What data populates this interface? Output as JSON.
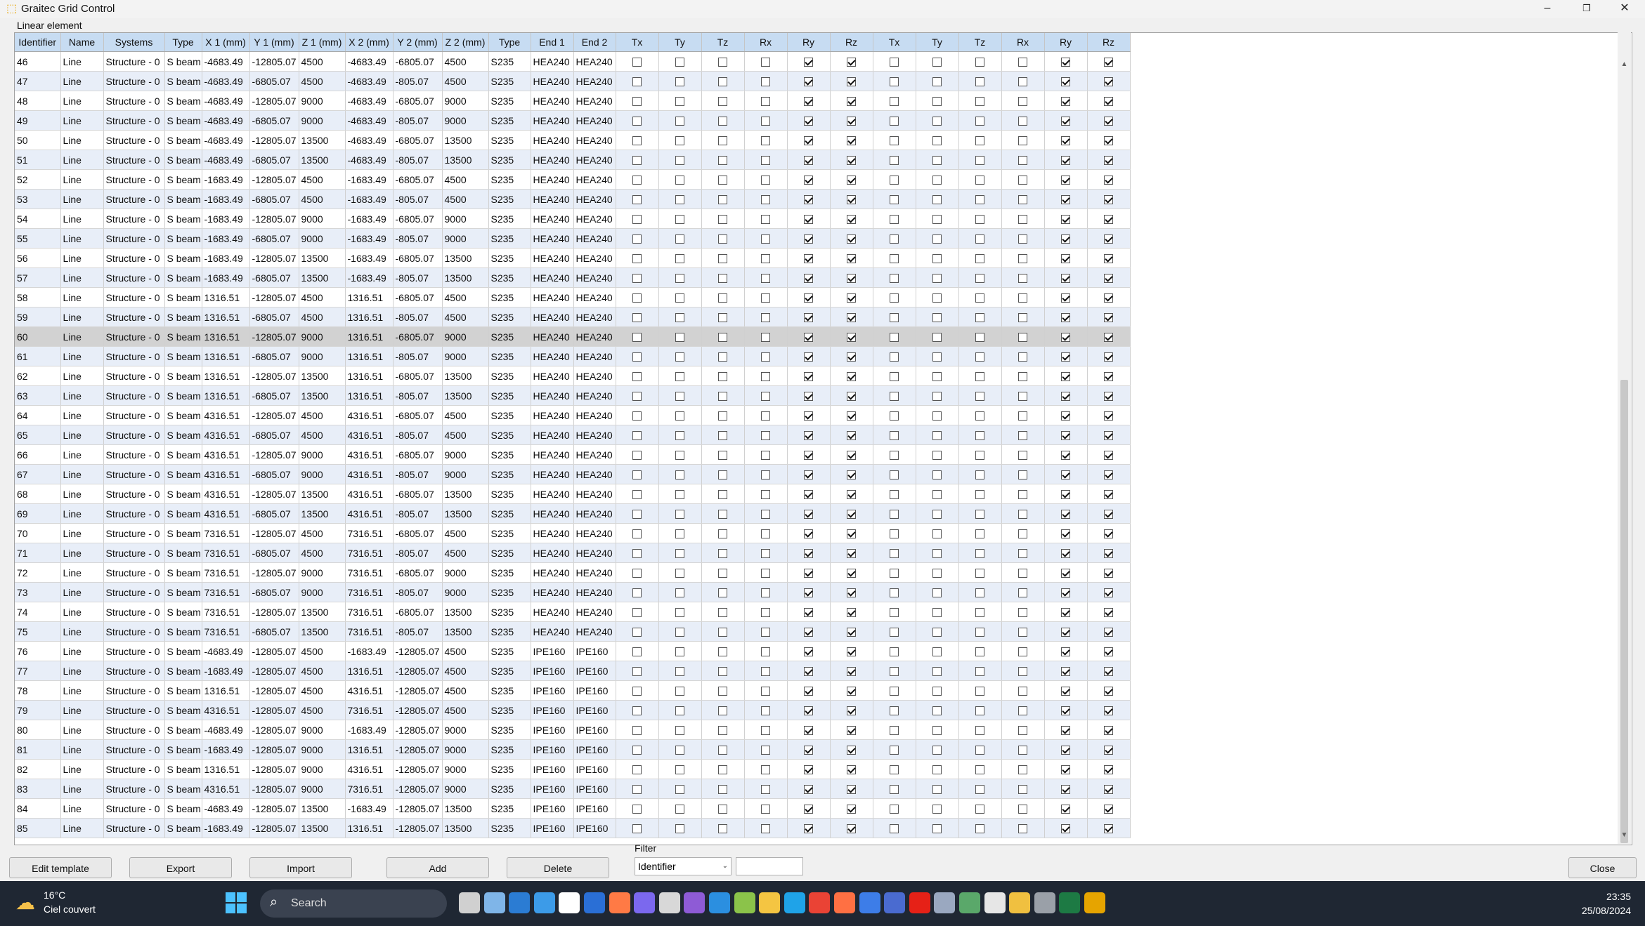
{
  "window": {
    "title": "Graitec Grid Control",
    "minimize": "–",
    "maximize": "❐",
    "close": "✕"
  },
  "section_label": "Linear element",
  "grid": {
    "columns": [
      "Identifier",
      "Name",
      "Systems",
      "Type",
      "X 1 (mm)",
      "Y 1 (mm)",
      "Z 1 (mm)",
      "X 2 (mm)",
      "Y 2 (mm)",
      "Z 2 (mm)",
      "Type",
      "End 1",
      "End 2",
      "Tx",
      "Ty",
      "Tz",
      "Rx",
      "Ry",
      "Rz",
      "Tx",
      "Ty",
      "Tz",
      "Rx",
      "Ry",
      "Rz"
    ],
    "selected_id": "60",
    "rows": [
      [
        "46",
        "Line",
        "Structure - 0",
        "S beam",
        "-4683.49",
        "-12805.07",
        "4500",
        "-4683.49",
        "-6805.07",
        "4500",
        "S235",
        "HEA240",
        "HEA240"
      ],
      [
        "47",
        "Line",
        "Structure - 0",
        "S beam",
        "-4683.49",
        "-6805.07",
        "4500",
        "-4683.49",
        "-805.07",
        "4500",
        "S235",
        "HEA240",
        "HEA240"
      ],
      [
        "48",
        "Line",
        "Structure - 0",
        "S beam",
        "-4683.49",
        "-12805.07",
        "9000",
        "-4683.49",
        "-6805.07",
        "9000",
        "S235",
        "HEA240",
        "HEA240"
      ],
      [
        "49",
        "Line",
        "Structure - 0",
        "S beam",
        "-4683.49",
        "-6805.07",
        "9000",
        "-4683.49",
        "-805.07",
        "9000",
        "S235",
        "HEA240",
        "HEA240"
      ],
      [
        "50",
        "Line",
        "Structure - 0",
        "S beam",
        "-4683.49",
        "-12805.07",
        "13500",
        "-4683.49",
        "-6805.07",
        "13500",
        "S235",
        "HEA240",
        "HEA240"
      ],
      [
        "51",
        "Line",
        "Structure - 0",
        "S beam",
        "-4683.49",
        "-6805.07",
        "13500",
        "-4683.49",
        "-805.07",
        "13500",
        "S235",
        "HEA240",
        "HEA240"
      ],
      [
        "52",
        "Line",
        "Structure - 0",
        "S beam",
        "-1683.49",
        "-12805.07",
        "4500",
        "-1683.49",
        "-6805.07",
        "4500",
        "S235",
        "HEA240",
        "HEA240"
      ],
      [
        "53",
        "Line",
        "Structure - 0",
        "S beam",
        "-1683.49",
        "-6805.07",
        "4500",
        "-1683.49",
        "-805.07",
        "4500",
        "S235",
        "HEA240",
        "HEA240"
      ],
      [
        "54",
        "Line",
        "Structure - 0",
        "S beam",
        "-1683.49",
        "-12805.07",
        "9000",
        "-1683.49",
        "-6805.07",
        "9000",
        "S235",
        "HEA240",
        "HEA240"
      ],
      [
        "55",
        "Line",
        "Structure - 0",
        "S beam",
        "-1683.49",
        "-6805.07",
        "9000",
        "-1683.49",
        "-805.07",
        "9000",
        "S235",
        "HEA240",
        "HEA240"
      ],
      [
        "56",
        "Line",
        "Structure - 0",
        "S beam",
        "-1683.49",
        "-12805.07",
        "13500",
        "-1683.49",
        "-6805.07",
        "13500",
        "S235",
        "HEA240",
        "HEA240"
      ],
      [
        "57",
        "Line",
        "Structure - 0",
        "S beam",
        "-1683.49",
        "-6805.07",
        "13500",
        "-1683.49",
        "-805.07",
        "13500",
        "S235",
        "HEA240",
        "HEA240"
      ],
      [
        "58",
        "Line",
        "Structure - 0",
        "S beam",
        "1316.51",
        "-12805.07",
        "4500",
        "1316.51",
        "-6805.07",
        "4500",
        "S235",
        "HEA240",
        "HEA240"
      ],
      [
        "59",
        "Line",
        "Structure - 0",
        "S beam",
        "1316.51",
        "-6805.07",
        "4500",
        "1316.51",
        "-805.07",
        "4500",
        "S235",
        "HEA240",
        "HEA240"
      ],
      [
        "60",
        "Line",
        "Structure - 0",
        "S beam",
        "1316.51",
        "-12805.07",
        "9000",
        "1316.51",
        "-6805.07",
        "9000",
        "S235",
        "HEA240",
        "HEA240"
      ],
      [
        "61",
        "Line",
        "Structure - 0",
        "S beam",
        "1316.51",
        "-6805.07",
        "9000",
        "1316.51",
        "-805.07",
        "9000",
        "S235",
        "HEA240",
        "HEA240"
      ],
      [
        "62",
        "Line",
        "Structure - 0",
        "S beam",
        "1316.51",
        "-12805.07",
        "13500",
        "1316.51",
        "-6805.07",
        "13500",
        "S235",
        "HEA240",
        "HEA240"
      ],
      [
        "63",
        "Line",
        "Structure - 0",
        "S beam",
        "1316.51",
        "-6805.07",
        "13500",
        "1316.51",
        "-805.07",
        "13500",
        "S235",
        "HEA240",
        "HEA240"
      ],
      [
        "64",
        "Line",
        "Structure - 0",
        "S beam",
        "4316.51",
        "-12805.07",
        "4500",
        "4316.51",
        "-6805.07",
        "4500",
        "S235",
        "HEA240",
        "HEA240"
      ],
      [
        "65",
        "Line",
        "Structure - 0",
        "S beam",
        "4316.51",
        "-6805.07",
        "4500",
        "4316.51",
        "-805.07",
        "4500",
        "S235",
        "HEA240",
        "HEA240"
      ],
      [
        "66",
        "Line",
        "Structure - 0",
        "S beam",
        "4316.51",
        "-12805.07",
        "9000",
        "4316.51",
        "-6805.07",
        "9000",
        "S235",
        "HEA240",
        "HEA240"
      ],
      [
        "67",
        "Line",
        "Structure - 0",
        "S beam",
        "4316.51",
        "-6805.07",
        "9000",
        "4316.51",
        "-805.07",
        "9000",
        "S235",
        "HEA240",
        "HEA240"
      ],
      [
        "68",
        "Line",
        "Structure - 0",
        "S beam",
        "4316.51",
        "-12805.07",
        "13500",
        "4316.51",
        "-6805.07",
        "13500",
        "S235",
        "HEA240",
        "HEA240"
      ],
      [
        "69",
        "Line",
        "Structure - 0",
        "S beam",
        "4316.51",
        "-6805.07",
        "13500",
        "4316.51",
        "-805.07",
        "13500",
        "S235",
        "HEA240",
        "HEA240"
      ],
      [
        "70",
        "Line",
        "Structure - 0",
        "S beam",
        "7316.51",
        "-12805.07",
        "4500",
        "7316.51",
        "-6805.07",
        "4500",
        "S235",
        "HEA240",
        "HEA240"
      ],
      [
        "71",
        "Line",
        "Structure - 0",
        "S beam",
        "7316.51",
        "-6805.07",
        "4500",
        "7316.51",
        "-805.07",
        "4500",
        "S235",
        "HEA240",
        "HEA240"
      ],
      [
        "72",
        "Line",
        "Structure - 0",
        "S beam",
        "7316.51",
        "-12805.07",
        "9000",
        "7316.51",
        "-6805.07",
        "9000",
        "S235",
        "HEA240",
        "HEA240"
      ],
      [
        "73",
        "Line",
        "Structure - 0",
        "S beam",
        "7316.51",
        "-6805.07",
        "9000",
        "7316.51",
        "-805.07",
        "9000",
        "S235",
        "HEA240",
        "HEA240"
      ],
      [
        "74",
        "Line",
        "Structure - 0",
        "S beam",
        "7316.51",
        "-12805.07",
        "13500",
        "7316.51",
        "-6805.07",
        "13500",
        "S235",
        "HEA240",
        "HEA240"
      ],
      [
        "75",
        "Line",
        "Structure - 0",
        "S beam",
        "7316.51",
        "-6805.07",
        "13500",
        "7316.51",
        "-805.07",
        "13500",
        "S235",
        "HEA240",
        "HEA240"
      ],
      [
        "76",
        "Line",
        "Structure - 0",
        "S beam",
        "-4683.49",
        "-12805.07",
        "4500",
        "-1683.49",
        "-12805.07",
        "4500",
        "S235",
        "IPE160",
        "IPE160"
      ],
      [
        "77",
        "Line",
        "Structure - 0",
        "S beam",
        "-1683.49",
        "-12805.07",
        "4500",
        "1316.51",
        "-12805.07",
        "4500",
        "S235",
        "IPE160",
        "IPE160"
      ],
      [
        "78",
        "Line",
        "Structure - 0",
        "S beam",
        "1316.51",
        "-12805.07",
        "4500",
        "4316.51",
        "-12805.07",
        "4500",
        "S235",
        "IPE160",
        "IPE160"
      ],
      [
        "79",
        "Line",
        "Structure - 0",
        "S beam",
        "4316.51",
        "-12805.07",
        "4500",
        "7316.51",
        "-12805.07",
        "4500",
        "S235",
        "IPE160",
        "IPE160"
      ],
      [
        "80",
        "Line",
        "Structure - 0",
        "S beam",
        "-4683.49",
        "-12805.07",
        "9000",
        "-1683.49",
        "-12805.07",
        "9000",
        "S235",
        "IPE160",
        "IPE160"
      ],
      [
        "81",
        "Line",
        "Structure - 0",
        "S beam",
        "-1683.49",
        "-12805.07",
        "9000",
        "1316.51",
        "-12805.07",
        "9000",
        "S235",
        "IPE160",
        "IPE160"
      ],
      [
        "82",
        "Line",
        "Structure - 0",
        "S beam",
        "1316.51",
        "-12805.07",
        "9000",
        "4316.51",
        "-12805.07",
        "9000",
        "S235",
        "IPE160",
        "IPE160"
      ],
      [
        "83",
        "Line",
        "Structure - 0",
        "S beam",
        "4316.51",
        "-12805.07",
        "9000",
        "7316.51",
        "-12805.07",
        "9000",
        "S235",
        "IPE160",
        "IPE160"
      ],
      [
        "84",
        "Line",
        "Structure - 0",
        "S beam",
        "-4683.49",
        "-12805.07",
        "13500",
        "-1683.49",
        "-12805.07",
        "13500",
        "S235",
        "IPE160",
        "IPE160"
      ],
      [
        "85",
        "Line",
        "Structure - 0",
        "S beam",
        "-1683.49",
        "-12805.07",
        "13500",
        "1316.51",
        "-12805.07",
        "13500",
        "S235",
        "IPE160",
        "IPE160"
      ]
    ],
    "releases": [
      false,
      false,
      false,
      false,
      true,
      true,
      false,
      false,
      false,
      false,
      true,
      true
    ]
  },
  "buttons": {
    "edit_template": "Edit template",
    "export": "Export",
    "import": "Import",
    "add": "Add",
    "delete": "Delete",
    "close": "Close"
  },
  "filter": {
    "label": "Filter",
    "field": "Identifier",
    "value": ""
  },
  "taskbar": {
    "weather_temp": "16°C",
    "weather_desc": "Ciel couvert",
    "search_label": "Search",
    "apps": [
      "task-view",
      "photos",
      "outlook",
      "pen-tool",
      "app-calendar",
      "calendar-2024",
      "drop-app",
      "vpn-app",
      "headset-app",
      "visual-studio",
      "vscode",
      "notepad-plus",
      "file-explorer",
      "edge",
      "chrome",
      "firefox-like",
      "store",
      "calculator",
      "youtube",
      "flow-app",
      "graitec-app",
      "openai-app",
      "bracket-app",
      "network-app",
      "excel",
      "graitec-active"
    ],
    "time": "23:35",
    "date": "25/08/2024"
  },
  "colors": {
    "header_bg": "#c7dcf2",
    "row_alt": "#e8eef8",
    "row_selected": "#d2d2d2",
    "taskbar_bg": "#1f2733"
  }
}
